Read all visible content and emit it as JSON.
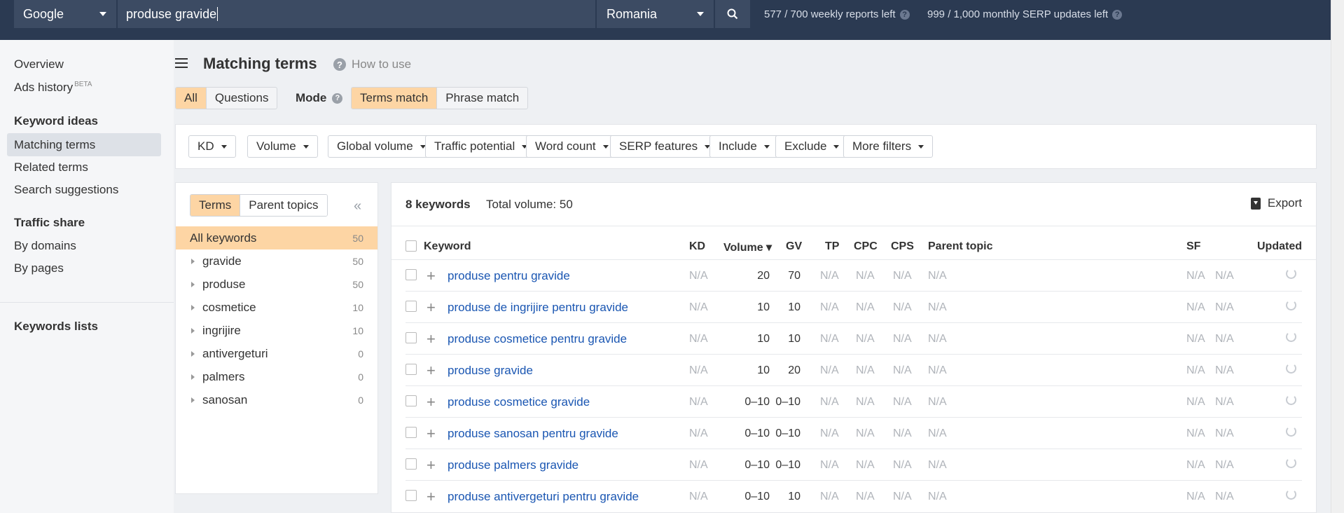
{
  "topbar": {
    "engine": "Google",
    "query": "produse gravide",
    "country": "Romania",
    "weekly_reports": "577 / 700 weekly reports left",
    "monthly_serp": "999 / 1,000 monthly SERP updates left",
    "help_glyph": "?"
  },
  "nav": {
    "overview": "Overview",
    "ads_history": "Ads history",
    "beta": "BETA",
    "keyword_ideas": "Keyword ideas",
    "matching_terms": "Matching terms",
    "related_terms": "Related terms",
    "search_suggestions": "Search suggestions",
    "traffic_share": "Traffic share",
    "by_domains": "By domains",
    "by_pages": "By pages",
    "keywords_lists": "Keywords lists"
  },
  "header": {
    "title": "Matching terms",
    "how_to_use": "How to use",
    "help_glyph": "?"
  },
  "toggles": {
    "all": "All",
    "questions": "Questions",
    "mode_label": "Mode",
    "terms_match": "Terms match",
    "phrase_match": "Phrase match"
  },
  "filters": [
    "KD",
    "Volume",
    "Global volume",
    "Traffic potential",
    "Word count",
    "SERP features",
    "Include",
    "Exclude",
    "More filters"
  ],
  "sidepanel": {
    "terms_tab": "Terms",
    "parent_topics_tab": "Parent topics",
    "collapse_glyph": "«",
    "items": [
      {
        "label": "All keywords",
        "count": "50"
      },
      {
        "label": "gravide",
        "count": "50"
      },
      {
        "label": "produse",
        "count": "50"
      },
      {
        "label": "cosmetice",
        "count": "10"
      },
      {
        "label": "ingrijire",
        "count": "10"
      },
      {
        "label": "antivergeturi",
        "count": "0"
      },
      {
        "label": "palmers",
        "count": "0"
      },
      {
        "label": "sanosan",
        "count": "0"
      }
    ]
  },
  "results": {
    "count": "8 keywords",
    "total_volume": "Total volume: 50",
    "export": "Export",
    "columns": {
      "keyword": "Keyword",
      "kd": "KD",
      "volume": "Volume ▾",
      "gv": "GV",
      "tp": "TP",
      "cpc": "CPC",
      "cps": "CPS",
      "parent_topic": "Parent topic",
      "sf": "SF",
      "updated": "Updated"
    },
    "na": "N/A",
    "plus": "+",
    "rows": [
      {
        "keyword": "produse pentru gravide",
        "volume": "20",
        "gv": "70"
      },
      {
        "keyword": "produse de ingrijire pentru gravide",
        "volume": "10",
        "gv": "10"
      },
      {
        "keyword": "produse cosmetice pentru gravide",
        "volume": "10",
        "gv": "10"
      },
      {
        "keyword": "produse gravide",
        "volume": "10",
        "gv": "20"
      },
      {
        "keyword": "produse cosmetice gravide",
        "volume": "0–10",
        "gv": "0–10"
      },
      {
        "keyword": "produse sanosan pentru gravide",
        "volume": "0–10",
        "gv": "0–10"
      },
      {
        "keyword": "produse palmers gravide",
        "volume": "0–10",
        "gv": "0–10"
      },
      {
        "keyword": "produse antivergeturi pentru gravide",
        "volume": "0–10",
        "gv": "10"
      }
    ]
  }
}
